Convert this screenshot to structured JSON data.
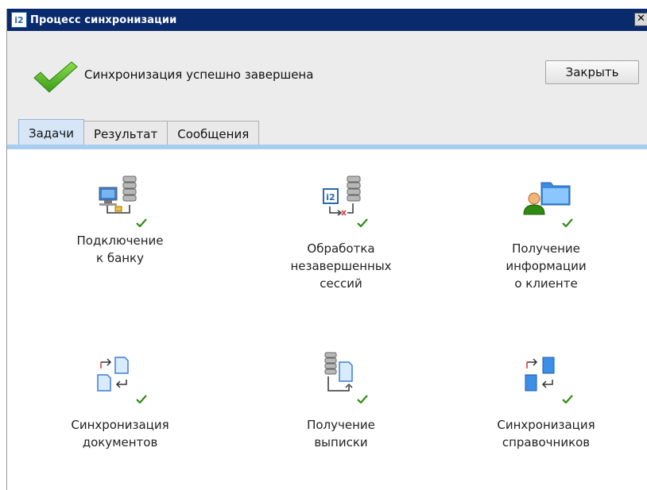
{
  "window": {
    "title": "Процесс синхронизации",
    "app_icon": "i2-app-icon",
    "close_glyph": "✕"
  },
  "status": {
    "message": "Синхронизация успешно завершена",
    "icon": "checkmark-icon"
  },
  "buttons": {
    "close_label": "Закрыть"
  },
  "tabs": [
    {
      "label": "Задачи",
      "active": true
    },
    {
      "label": "Результат",
      "active": false
    },
    {
      "label": "Сообщения",
      "active": false
    }
  ],
  "tasks": [
    {
      "line1": "Подключение",
      "line2": "к банку",
      "line3": "",
      "icon": "bank-connection-icon",
      "done": true
    },
    {
      "line1": "Обработка",
      "line2": "незавершенных",
      "line3": "сессий",
      "icon": "session-processing-icon",
      "done": true
    },
    {
      "line1": "Получение",
      "line2": "информации",
      "line3": "о клиенте",
      "icon": "client-info-icon",
      "done": true
    },
    {
      "line1": "Синхронизация",
      "line2": "документов",
      "line3": "",
      "icon": "documents-sync-icon",
      "done": true
    },
    {
      "line1": "Получение",
      "line2": "выписки",
      "line3": "",
      "icon": "statement-icon",
      "done": true
    },
    {
      "line1": "Синхронизация",
      "line2": "справочников",
      "line3": "",
      "icon": "directories-sync-icon",
      "done": true
    }
  ],
  "colors": {
    "titlebar": "#0a2a6e",
    "tab_strip": "#a8cdf0",
    "success": "#3a9a1a"
  }
}
